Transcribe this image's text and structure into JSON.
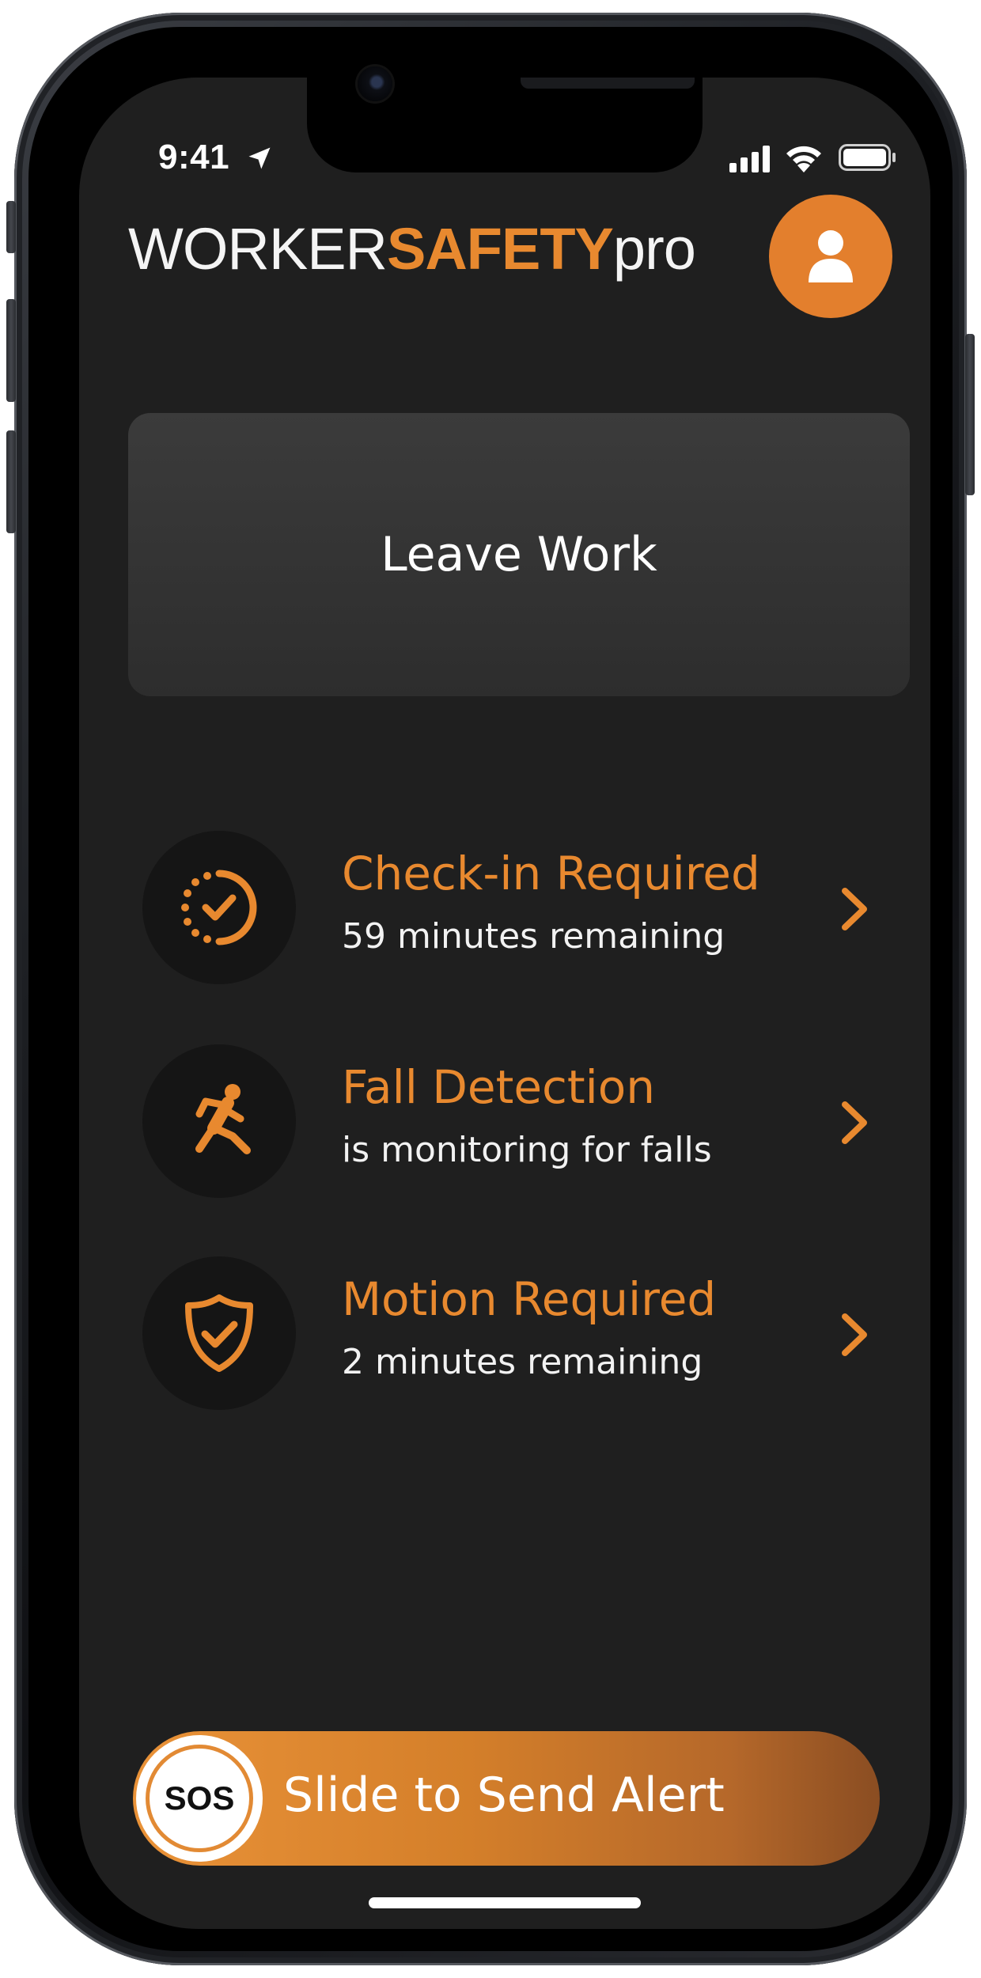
{
  "status_bar": {
    "time": "9:41"
  },
  "header": {
    "logo_part1": "WORKER",
    "logo_part2": "SAFETY",
    "logo_part3": "pro"
  },
  "actions": {
    "leave_work_label": "Leave Work"
  },
  "status_items": [
    {
      "title": "Check-in Required",
      "subtitle": "59 minutes remaining",
      "icon": "timer-check-icon"
    },
    {
      "title": "Fall Detection",
      "subtitle": "is monitoring for falls",
      "icon": "falling-person-icon"
    },
    {
      "title": "Motion Required",
      "subtitle": "2 minutes remaining",
      "icon": "shield-check-icon"
    }
  ],
  "sos": {
    "knob_label": "SOS",
    "slide_label": "Slide to Send Alert"
  },
  "colors": {
    "accent": "#e8892f",
    "background": "#1f1f1f",
    "card": "#333333"
  }
}
